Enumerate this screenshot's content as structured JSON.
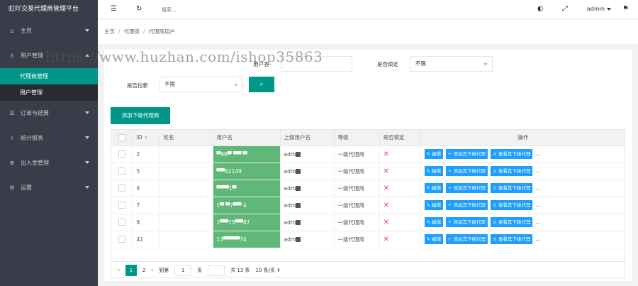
{
  "sidebar": {
    "title": "虹吖交易代理商管理平台",
    "items": [
      {
        "label": "主页",
        "icon": "home-icon",
        "glyph": "⌂"
      },
      {
        "label": "用户管理",
        "icon": "user-icon",
        "glyph": "♙",
        "sub": [
          "代理商管理",
          "用户管理"
        ]
      },
      {
        "label": "订单与结算",
        "icon": "list-icon",
        "glyph": "☰"
      },
      {
        "label": "统计报表",
        "icon": "chart-icon",
        "glyph": "⌇"
      },
      {
        "label": "出入金管理",
        "icon": "money-icon",
        "glyph": "⊛"
      },
      {
        "label": "设置",
        "icon": "gear-icon",
        "glyph": "⚙"
      }
    ]
  },
  "header": {
    "search_placeholder": "搜索...",
    "admin": "admin",
    "flag_icon": "flag-icon"
  },
  "breadcrumb": [
    "主页",
    "代理商",
    "代理商用户"
  ],
  "filters": {
    "username_label": "用户名",
    "locked_label": "是否锁定",
    "locked_value": "不限",
    "refresh_label": "是否拉新",
    "refresh_value": "不限"
  },
  "add_button": "添加下级代理商",
  "table": {
    "headers": [
      "ID",
      "姓名",
      "用户名",
      "上级用户名",
      "等级",
      "是否锁定",
      "操作"
    ],
    "rows": [
      {
        "id": "2",
        "name": "",
        "username": "▀96▀ ▀▀ ▀",
        "parent": "adm",
        "level": "一级代理商",
        "locked": "✕"
      },
      {
        "id": "5",
        "name": "",
        "username": "▀▀62149",
        "parent": "adm",
        "level": "一级代理商",
        "locked": "✕"
      },
      {
        "id": "6",
        "name": "",
        "username": "▀▀▀1▀",
        "parent": "adm",
        "level": "一级代理商",
        "locked": "✕"
      },
      {
        "id": "7",
        "name": "",
        "username": "1▀ ▀7▀▀ 4",
        "parent": "adm",
        "level": "一级代理商",
        "locked": "✕"
      },
      {
        "id": "8",
        "name": "",
        "username": "1▀▀75▀▀87",
        "parent": "adm",
        "level": "一级代理商",
        "locked": "✕"
      },
      {
        "id": "42",
        "name": "",
        "username": "13▀▀▀▀74",
        "parent": "adm",
        "level": "一级代理商",
        "locked": "✕"
      }
    ],
    "ops": [
      "编辑",
      "添加其下级代理",
      "查看其下级代理"
    ],
    "more": "..."
  },
  "pager": {
    "current": "1",
    "next": "2",
    "goto_label": "到第",
    "goto_value": "1",
    "page_label": "页",
    "total": "共 13 条",
    "per_page": "10 条/页"
  },
  "watermark": "https://www.huzhan.com/ishop35863"
}
